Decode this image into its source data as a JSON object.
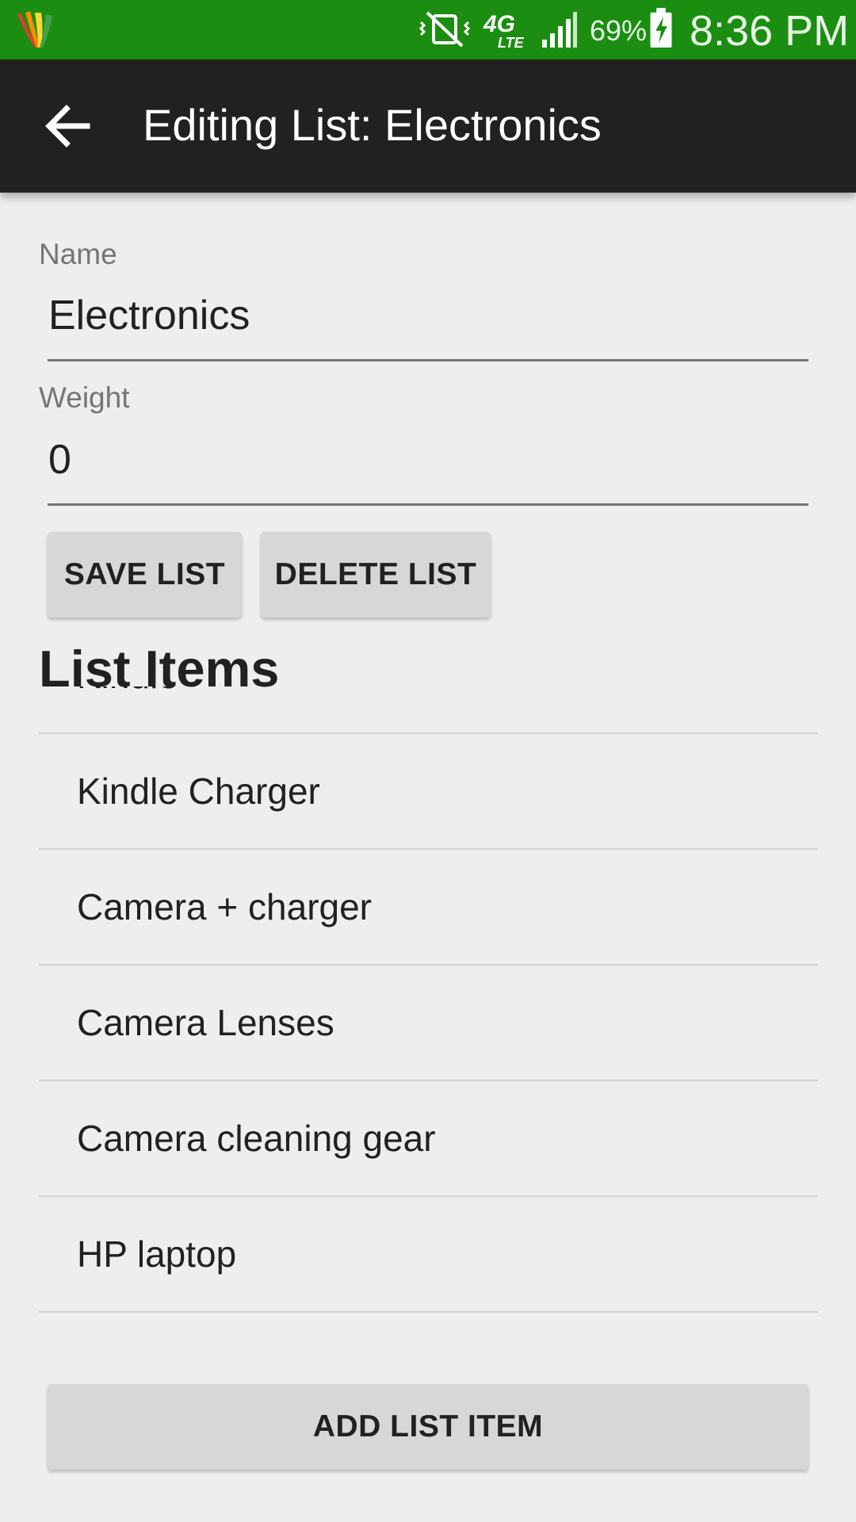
{
  "status_bar": {
    "battery_percent": "69%",
    "time": "8:36 PM",
    "network": "4G LTE"
  },
  "app_bar": {
    "title": "Editing List: Electronics"
  },
  "form": {
    "name_label": "Name",
    "name_value": "Electronics",
    "weight_label": "Weight",
    "weight_value": "0"
  },
  "actions": {
    "save_label": "SAVE LIST",
    "delete_label": "DELETE LIST",
    "add_item_label": "ADD LIST ITEM"
  },
  "list_section": {
    "title": "List Items",
    "items": [
      {
        "label": "Kindle"
      },
      {
        "label": "Kindle Charger"
      },
      {
        "label": "Camera + charger"
      },
      {
        "label": "Camera Lenses"
      },
      {
        "label": "Camera cleaning gear"
      },
      {
        "label": "HP laptop"
      }
    ]
  },
  "colors": {
    "status_bar": "#1b8e12",
    "app_bar": "#212121",
    "background": "#eeeeee",
    "button": "#d6d7d7"
  }
}
